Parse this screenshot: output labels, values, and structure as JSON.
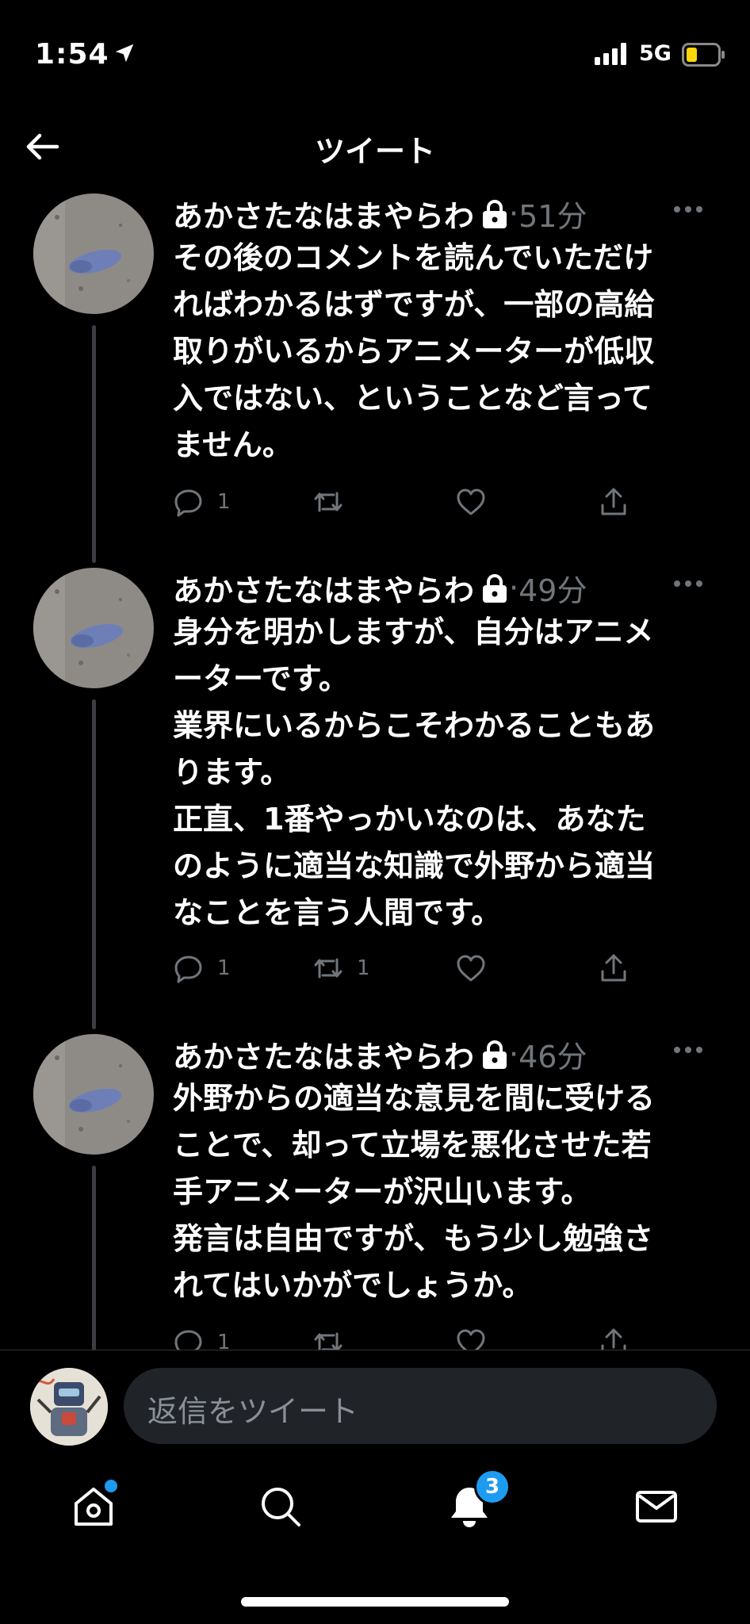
{
  "status_bar": {
    "time": "1:54",
    "network": "5G"
  },
  "header": {
    "title": "ツイート"
  },
  "tweets": [
    {
      "author": "あかさたなはまやらわ",
      "separator": "·",
      "age": "51分",
      "lines": [
        "その後のコメントを読んでいただけ",
        "ればわかるはずですが、一部の高給",
        "取りがいるからアニメーターが低収",
        "入ではない、ということなど言って",
        "ません。"
      ],
      "reply_count": "1",
      "retweet_count": "",
      "like_count": ""
    },
    {
      "author": "あかさたなはまやらわ",
      "separator": "·",
      "age": "49分",
      "lines": [
        "身分を明かしますが、自分はアニメ",
        "ーターです。",
        "業界にいるからこそわかることもあ",
        "ります。",
        "正直、1番やっかいなのは、あなた",
        "のように適当な知識で外野から適当",
        "なことを言う人間です。"
      ],
      "reply_count": "1",
      "retweet_count": "1",
      "like_count": ""
    },
    {
      "author": "あかさたなはまやらわ",
      "separator": "·",
      "age": "46分",
      "lines": [
        "外野からの適当な意見を間に受ける",
        "ことで、却って立場を悪化させた若",
        "手アニメーターが沢山います。",
        "発言は自由ですが、もう少し勉強さ",
        "れてはいかがでしょうか。"
      ],
      "reply_count": "1",
      "retweet_count": "",
      "like_count": ""
    }
  ],
  "reply_bar": {
    "placeholder": "返信をツイート"
  },
  "tab_bar": {
    "items": [
      "home-icon",
      "search-icon",
      "notifications-icon",
      "messages-icon"
    ],
    "notifications_badge": "3"
  },
  "colors": {
    "accent": "#1d9bf0",
    "muted": "#71767b",
    "background": "#000000"
  }
}
